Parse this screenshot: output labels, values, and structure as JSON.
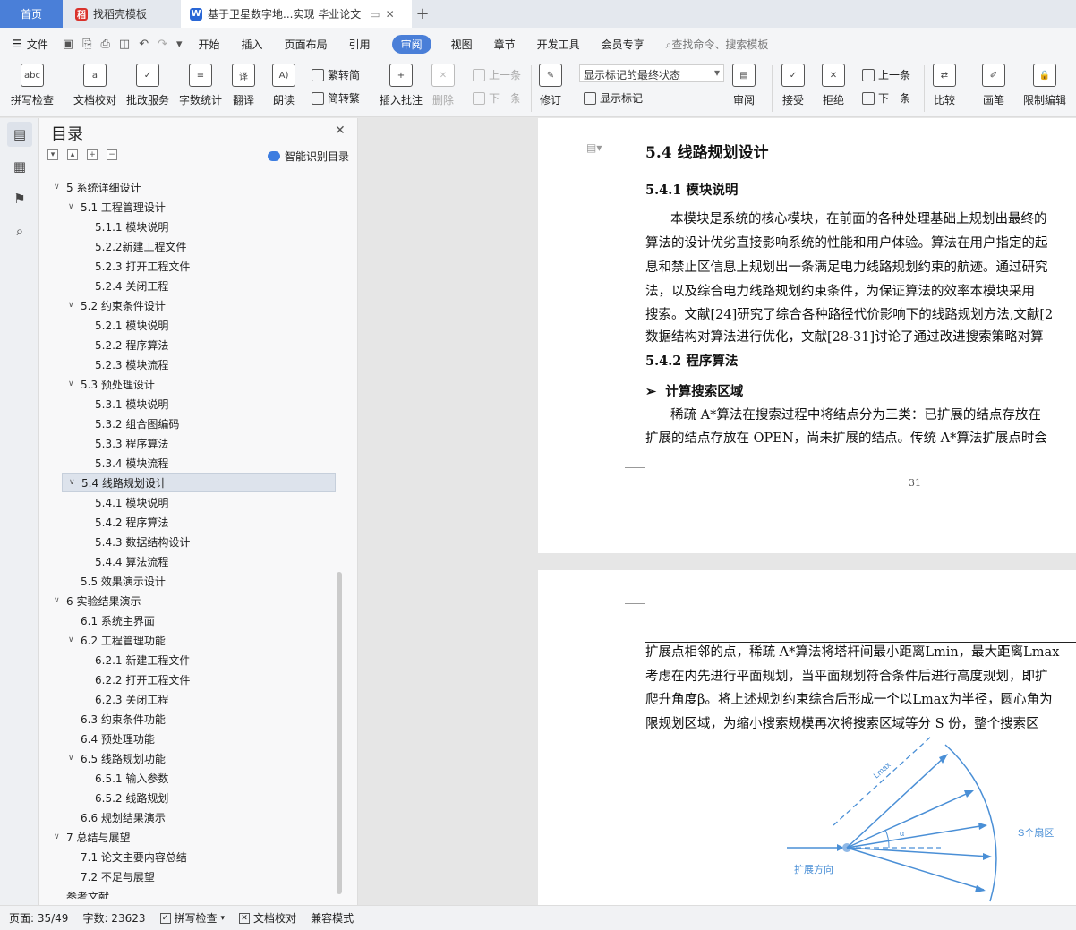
{
  "tabs": {
    "home": "首页",
    "template": "找稻壳模板",
    "document": "基于卫星数字地...实现 毕业论文"
  },
  "menu": {
    "file": "文件",
    "items": [
      "开始",
      "插入",
      "页面布局",
      "引用",
      "审阅",
      "视图",
      "章节",
      "开发工具",
      "会员专享"
    ],
    "active": "审阅",
    "search": "查找命令、搜索模板"
  },
  "ribbon": {
    "spell": "拼写检查",
    "proof": "文档校对",
    "batch": "批改服务",
    "wordcount": "字数统计",
    "translate": "翻译",
    "read": "朗读",
    "trad": "繁转简",
    "simp": "简转繁",
    "comment": "插入批注",
    "delete": "删除",
    "prev_c": "上一条",
    "next_c": "下一条",
    "track": "修订",
    "markup_select": "显示标记的最终状态",
    "show_markup": "显示标记",
    "review": "审阅",
    "accept": "接受",
    "reject": "拒绝",
    "prev": "上一条",
    "next": "下一条",
    "compare": "比较",
    "pen": "画笔",
    "restrict": "限制编辑"
  },
  "nav": {
    "title": "目录",
    "smart": "智能识别目录",
    "items": [
      {
        "t": "5  系统详细设计",
        "lvl": 1,
        "c": "v"
      },
      {
        "t": "5.1  工程管理设计",
        "lvl": 2,
        "c": "v"
      },
      {
        "t": "5.1.1  模块说明",
        "lvl": 3
      },
      {
        "t": "5.2.2新建工程文件",
        "lvl": 3
      },
      {
        "t": "5.2.3  打开工程文件",
        "lvl": 3
      },
      {
        "t": "5.2.4  关闭工程",
        "lvl": 3
      },
      {
        "t": "5.2  约束条件设计",
        "lvl": 2,
        "c": "v"
      },
      {
        "t": "5.2.1  模块说明",
        "lvl": 3
      },
      {
        "t": "5.2.2  程序算法",
        "lvl": 3
      },
      {
        "t": "5.2.3  模块流程",
        "lvl": 3
      },
      {
        "t": "5.3  预处理设计",
        "lvl": 2,
        "c": "v"
      },
      {
        "t": "5.3.1  模块说明",
        "lvl": 3
      },
      {
        "t": "5.3.2  组合图编码",
        "lvl": 3
      },
      {
        "t": "5.3.3  程序算法",
        "lvl": 3
      },
      {
        "t": "5.3.4  模块流程",
        "lvl": 3
      },
      {
        "t": "5.4  线路规划设计",
        "lvl": 2,
        "c": "v",
        "sel": true
      },
      {
        "t": "5.4.1  模块说明",
        "lvl": 3
      },
      {
        "t": "5.4.2  程序算法",
        "lvl": 3
      },
      {
        "t": "5.4.3  数据结构设计",
        "lvl": 3
      },
      {
        "t": "5.4.4  算法流程",
        "lvl": 3
      },
      {
        "t": "5.5  效果演示设计",
        "lvl": 2
      },
      {
        "t": "6  实验结果演示",
        "lvl": 1,
        "c": "v"
      },
      {
        "t": "6.1  系统主界面",
        "lvl": 2
      },
      {
        "t": "6.2  工程管理功能",
        "lvl": 2,
        "c": "v"
      },
      {
        "t": "6.2.1  新建工程文件",
        "lvl": 3
      },
      {
        "t": "6.2.2  打开工程文件",
        "lvl": 3
      },
      {
        "t": "6.2.3  关闭工程",
        "lvl": 3
      },
      {
        "t": "6.3  约束条件功能",
        "lvl": 2
      },
      {
        "t": "6.4  预处理功能",
        "lvl": 2
      },
      {
        "t": "6.5  线路规划功能",
        "lvl": 2,
        "c": "v"
      },
      {
        "t": "6.5.1  输入参数",
        "lvl": 3
      },
      {
        "t": "6.5.2  线路规划",
        "lvl": 3
      },
      {
        "t": "6.6  规划结果演示",
        "lvl": 2
      },
      {
        "t": "7  总结与展望",
        "lvl": 1,
        "c": "v"
      },
      {
        "t": "7.1  论文主要内容总结",
        "lvl": 2
      },
      {
        "t": "7.2  不足与展望",
        "lvl": 2
      },
      {
        "t": "参考文献",
        "lvl": 1
      }
    ]
  },
  "page1": {
    "h2": "5.4  线路规划设计",
    "h3a": "5.4.1  模块说明",
    "lines": [
      "本模块是系统的核心模块，在前面的各种处理基础上规划出最终的",
      "算法的设计优劣直接影响系统的性能和用户体验。算法在用户指定的起",
      "息和禁止区信息上规划出一条满足电力线路规划约束的航迹。通过研究",
      "法，以及综合电力线路规划约束条件，为保证算法的效率本模块采用",
      "搜索。文献[24]研究了综合各种路径代价影响下的线路规划方法,文献[2",
      "数据结构对算法进行优化，文献[28-31]讨论了通过改进搜索策略对算"
    ],
    "h3b": "5.4.2  程序算法",
    "bullet": "计算搜索区域",
    "blines": [
      "稀疏 A*算法在搜索过程中将结点分为三类：已扩展的结点存放在",
      "扩展的结点存放在 OPEN，尚未扩展的结点。传统 A*算法扩展点时会"
    ],
    "pageno": "31"
  },
  "page2": {
    "lines": [
      "扩展点相邻的点，稀疏 A*算法将塔杆间最小距离Lmin，最大距离Lmax",
      "考虑在内先进行平面规划，当平面规划符合条件后进行高度规划，即扩",
      "爬升角度β。将上述规划约束综合后形成一个以Lmax为半径，圆心角为",
      "限规划区域，为缩小搜索规模再次将搜索区域等分 S 份，整个搜索区"
    ],
    "fig": {
      "lmax": "Lmax",
      "alpha": "α",
      "sectors": "S个扇区",
      "direction": "扩展方向"
    }
  },
  "status": {
    "page": "页面: 35/49",
    "words": "字数: 23623",
    "spell": "拼写检查",
    "proof": "文档校对",
    "compat": "兼容模式"
  }
}
